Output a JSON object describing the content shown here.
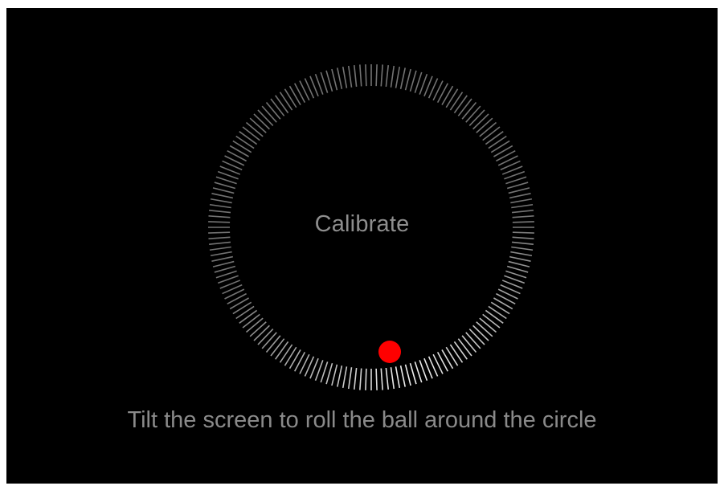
{
  "calibration": {
    "title": "Calibrate",
    "instruction": "Tilt the screen to roll the ball around the circle",
    "ball_color": "#ff0000",
    "tick_color": "#ffffff"
  }
}
